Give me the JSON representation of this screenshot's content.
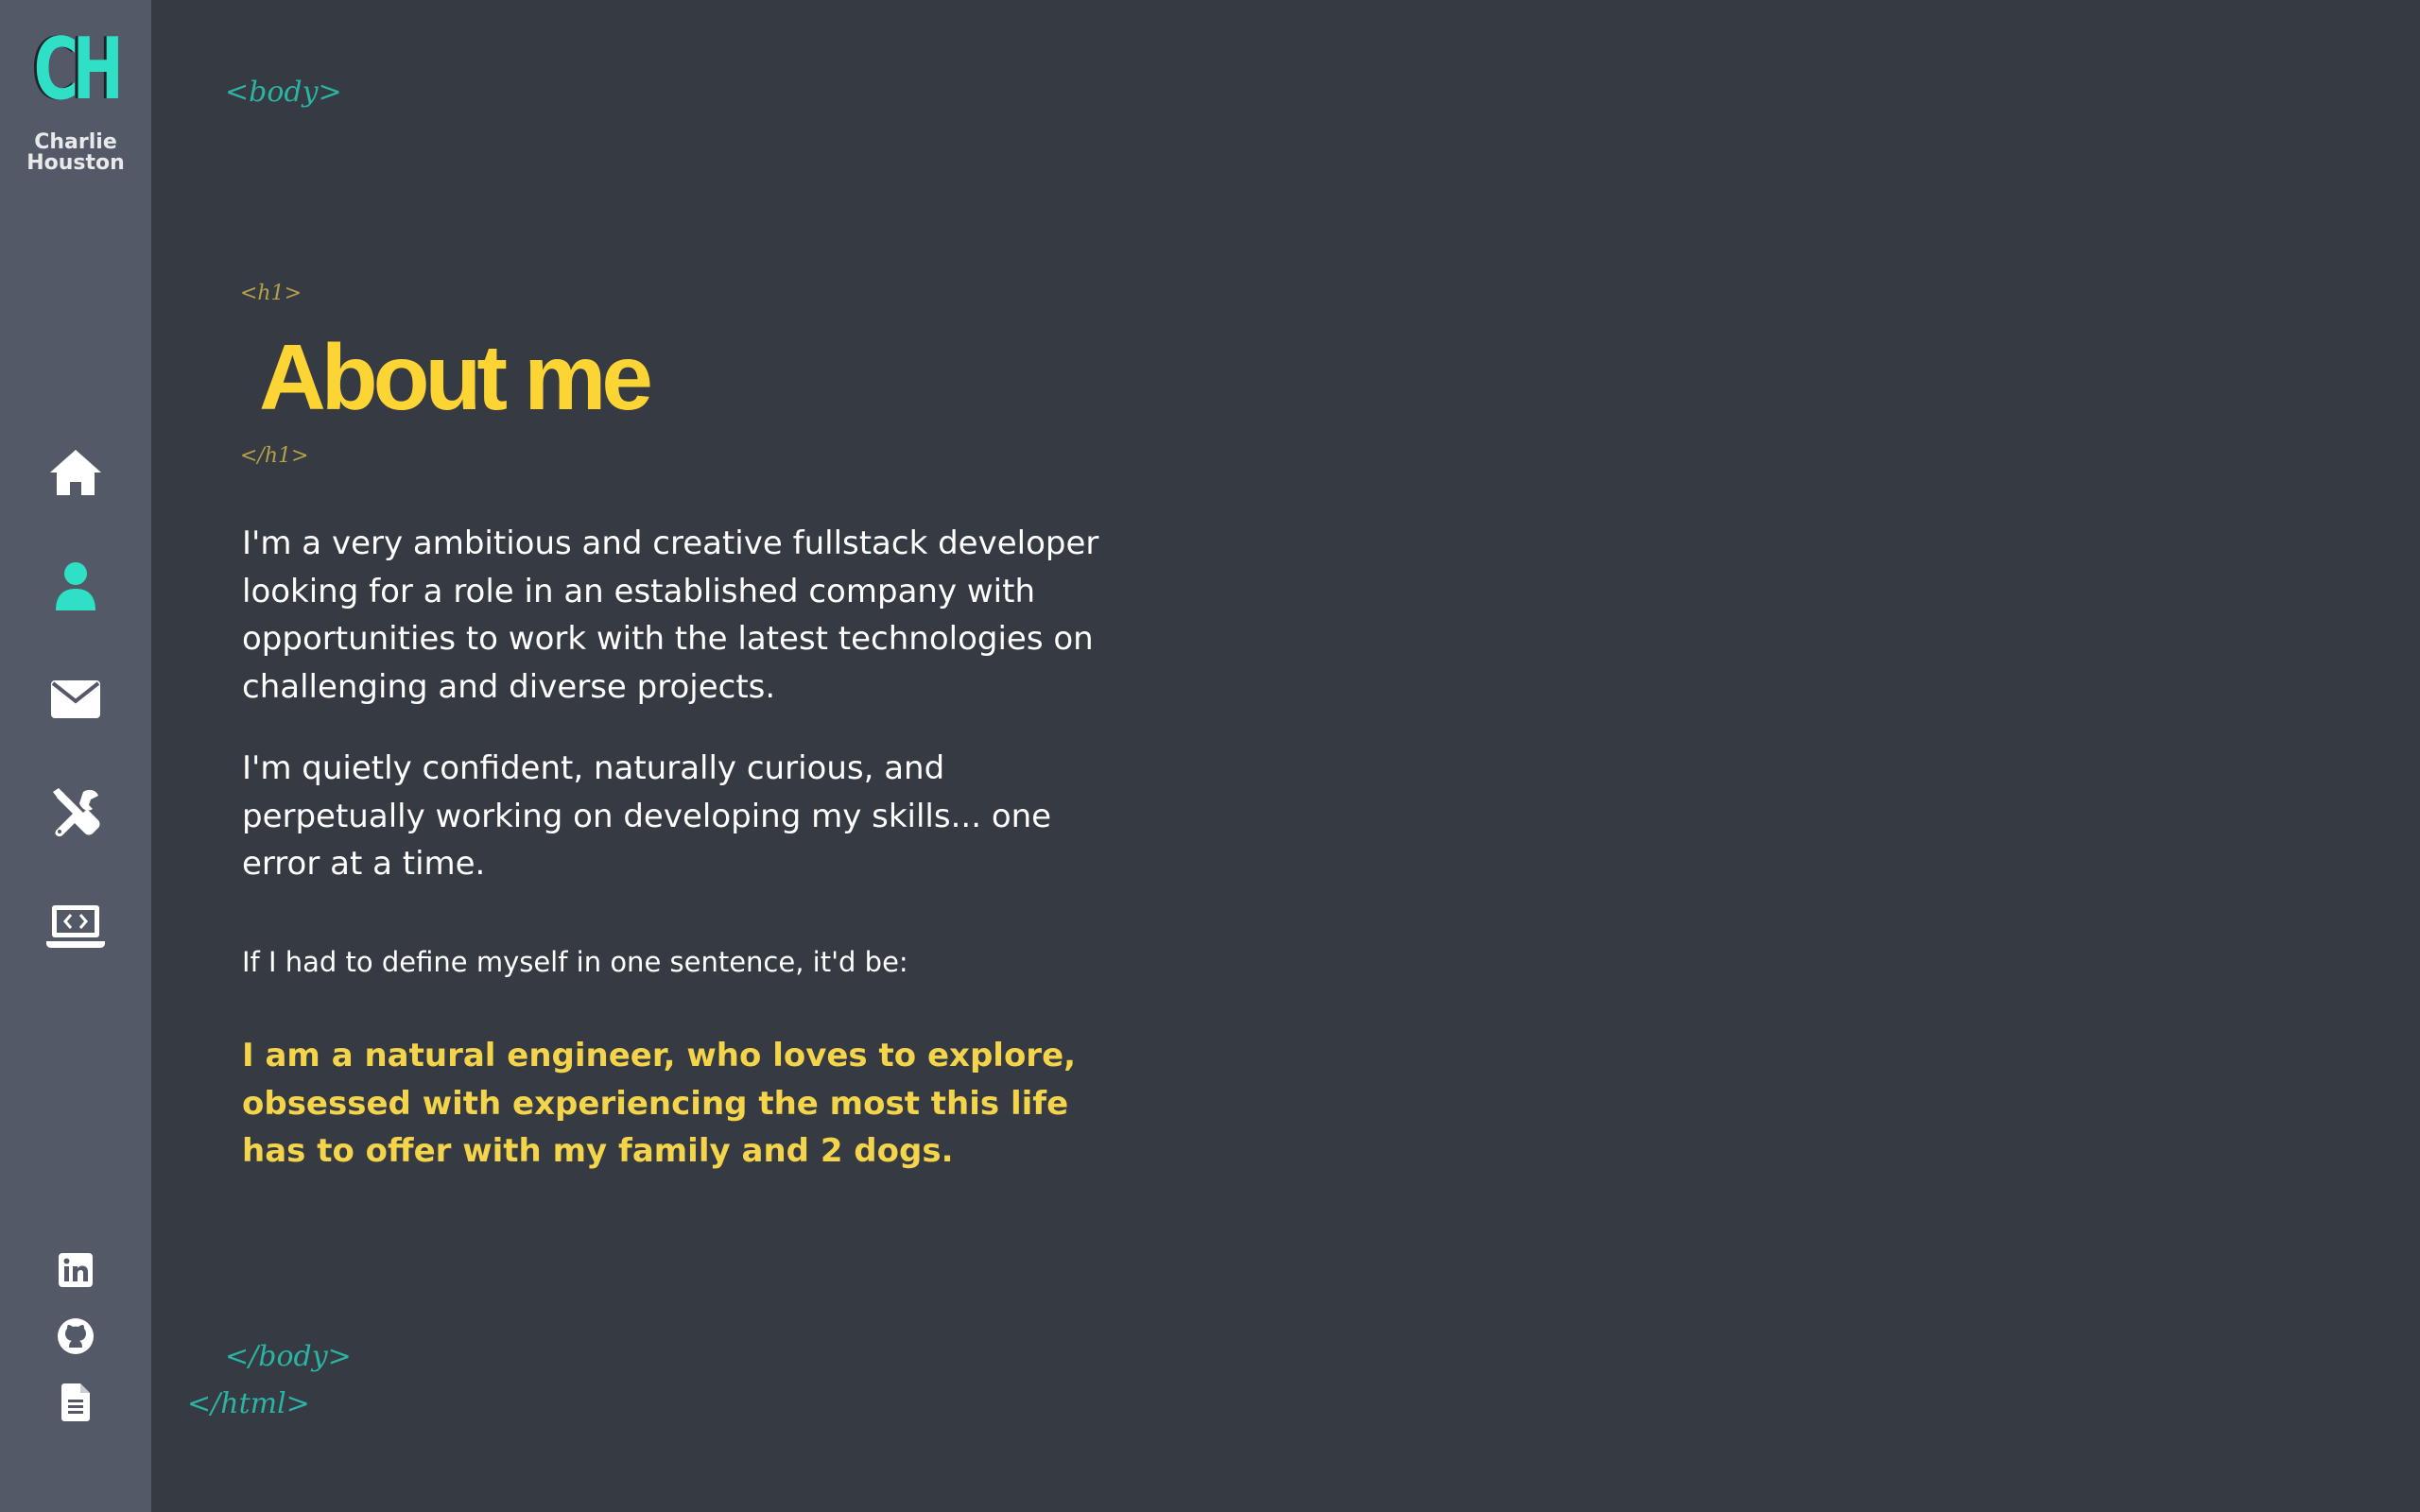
{
  "brand": {
    "logo_text": "CH",
    "name_line1": "Charlie",
    "name_line2": "Houston",
    "logo_color": "#2fe0c6"
  },
  "nav": {
    "items": [
      {
        "id": "home",
        "icon": "home-icon",
        "active": false
      },
      {
        "id": "about",
        "icon": "user-icon",
        "active": true
      },
      {
        "id": "contact",
        "icon": "envelope-icon",
        "active": false
      },
      {
        "id": "skills",
        "icon": "tools-icon",
        "active": false
      },
      {
        "id": "projects",
        "icon": "laptop-code-icon",
        "active": false
      }
    ],
    "active_color": "#2fe0c6",
    "inactive_color": "#ffffff"
  },
  "social": {
    "items": [
      {
        "id": "linkedin",
        "icon": "linkedin-icon"
      },
      {
        "id": "github",
        "icon": "github-icon"
      },
      {
        "id": "resume",
        "icon": "file-text-icon"
      }
    ]
  },
  "tags": {
    "body_open": "<body>",
    "h1_open": "<h1>",
    "h1_close": "</h1>",
    "body_close": "</body>",
    "html_close": "</html>"
  },
  "main": {
    "title": "About me",
    "paragraphs": [
      "I'm a very ambitious and creative fullstack developer looking for a role in an established company with opportunities to work with the latest technologies on challenging and diverse projects.",
      "I'm quietly confident, naturally curious, and perpetually working on developing my skills... one error at a time."
    ],
    "lead_in": "If I had to define myself in one sentence, it'd be:",
    "quote": "I am a natural engineer, who loves to explore, obsessed with experiencing the most this life has to offer with my family and 2 dogs."
  },
  "colors": {
    "background": "#363a43",
    "sidebar": "#535966",
    "accent_yellow": "#fcd535",
    "accent_teal": "#2bb3a3"
  }
}
